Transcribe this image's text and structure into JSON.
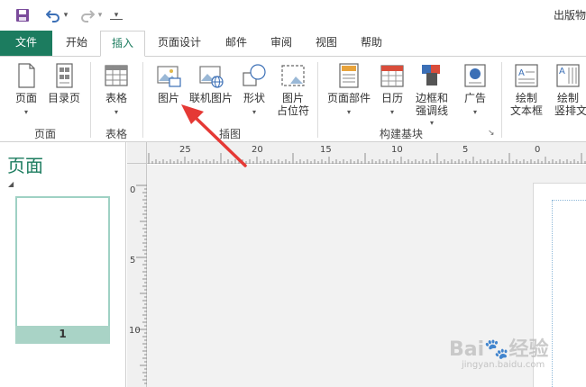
{
  "app": {
    "title": "出版物"
  },
  "qat": {
    "undo_caret": "▾",
    "redo_caret": "▾",
    "customize": "▾"
  },
  "tabs": [
    {
      "label": "文件"
    },
    {
      "label": "开始"
    },
    {
      "label": "插入"
    },
    {
      "label": "页面设计"
    },
    {
      "label": "邮件"
    },
    {
      "label": "审阅"
    },
    {
      "label": "视图"
    },
    {
      "label": "帮助"
    }
  ],
  "ribbon": {
    "groups": {
      "pages": "页面",
      "tables": "表格",
      "illustrations": "插图",
      "building_blocks": "构建基块"
    },
    "buttons": {
      "page": "页面",
      "catalog_page": "目录页",
      "table": "表格",
      "picture": "图片",
      "online_picture": "联机图片",
      "shapes": "形状",
      "picture_placeholder_1": "图片",
      "picture_placeholder_2": "占位符",
      "page_parts": "页面部件",
      "calendar": "日历",
      "borders_1": "边框和",
      "borders_2": "强调线",
      "advertisement": "广告",
      "draw_textbox_1": "绘制",
      "draw_textbox_2": "文本框",
      "draw_vtextbox_1": "绘制",
      "draw_vtextbox_2": "竖排文本"
    },
    "caret": "▾",
    "launcher": "↘"
  },
  "pages_pane": {
    "title": "页面",
    "collapse": "◢",
    "thumb_number": "1"
  },
  "ruler": {
    "h_labels": [
      "25",
      "20",
      "15",
      "10",
      "5",
      "0"
    ],
    "v_labels": [
      "0",
      "5",
      "10"
    ]
  },
  "watermark": {
    "main": "Bai🐾经验",
    "sub": "jingyan.baidu.com"
  },
  "colors": {
    "accent": "#1c7c5f",
    "arrow": "#e53935",
    "thumb": "#a9d3c6"
  }
}
